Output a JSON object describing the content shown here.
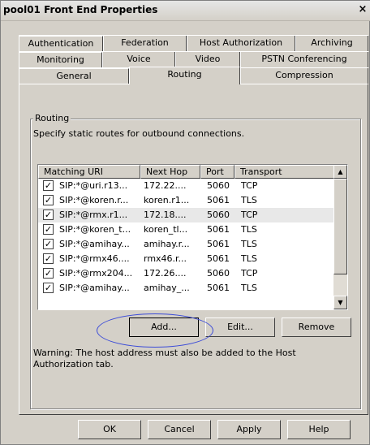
{
  "window": {
    "title": "pool01 Front End Properties",
    "close_glyph": "×"
  },
  "tabs": {
    "row1": [
      "Authentication",
      "Federation",
      "Host Authorization",
      "Archiving"
    ],
    "row2": [
      "Monitoring",
      "Voice",
      "Video",
      "PSTN Conferencing"
    ],
    "row3": [
      "General",
      "Routing",
      "Compression"
    ],
    "active": "Routing"
  },
  "routing": {
    "group_label": "Routing",
    "description": "Specify static routes for outbound connections.",
    "columns": [
      "Matching URI",
      "Next Hop",
      "Port",
      "Transport"
    ],
    "rows": [
      {
        "uri": "SIP:*@uri.r13...",
        "hop": "172.22....",
        "port": "5060",
        "transport": "TCP",
        "checked": true
      },
      {
        "uri": "SIP:*@koren.r...",
        "hop": "koren.r1...",
        "port": "5061",
        "transport": "TLS",
        "checked": true
      },
      {
        "uri": "SIP:*@rmx.r1...",
        "hop": "172.18....",
        "port": "5060",
        "transport": "TCP",
        "checked": true,
        "selected": true
      },
      {
        "uri": "SIP:*@koren_t...",
        "hop": "koren_tl...",
        "port": "5061",
        "transport": "TLS",
        "checked": true
      },
      {
        "uri": "SIP:*@amihay...",
        "hop": "amihay.r...",
        "port": "5061",
        "transport": "TLS",
        "checked": true
      },
      {
        "uri": "SIP:*@rmx46....",
        "hop": "rmx46.r...",
        "port": "5061",
        "transport": "TLS",
        "checked": true
      },
      {
        "uri": "SIP:*@rmx204...",
        "hop": "172.26....",
        "port": "5060",
        "transport": "TCP",
        "checked": true
      },
      {
        "uri": "SIP:*@amihay...",
        "hop": "amihay_...",
        "port": "5061",
        "transport": "TLS",
        "checked": true
      }
    ],
    "buttons": {
      "add": "Add...",
      "edit": "Edit...",
      "remove": "Remove"
    },
    "warning": "Warning: The host address must also be added to the Host Authorization tab."
  },
  "footer": {
    "ok": "OK",
    "cancel": "Cancel",
    "apply": "Apply",
    "help": "Help"
  },
  "colors": {
    "dialog_bg": "#d4d0c8",
    "highlight_ellipse": "#3a4ad8"
  },
  "icons": {
    "close": "close-icon",
    "scroll_up": "arrow-up-icon",
    "scroll_down": "arrow-down-icon",
    "checkbox": "checkmark-icon"
  }
}
